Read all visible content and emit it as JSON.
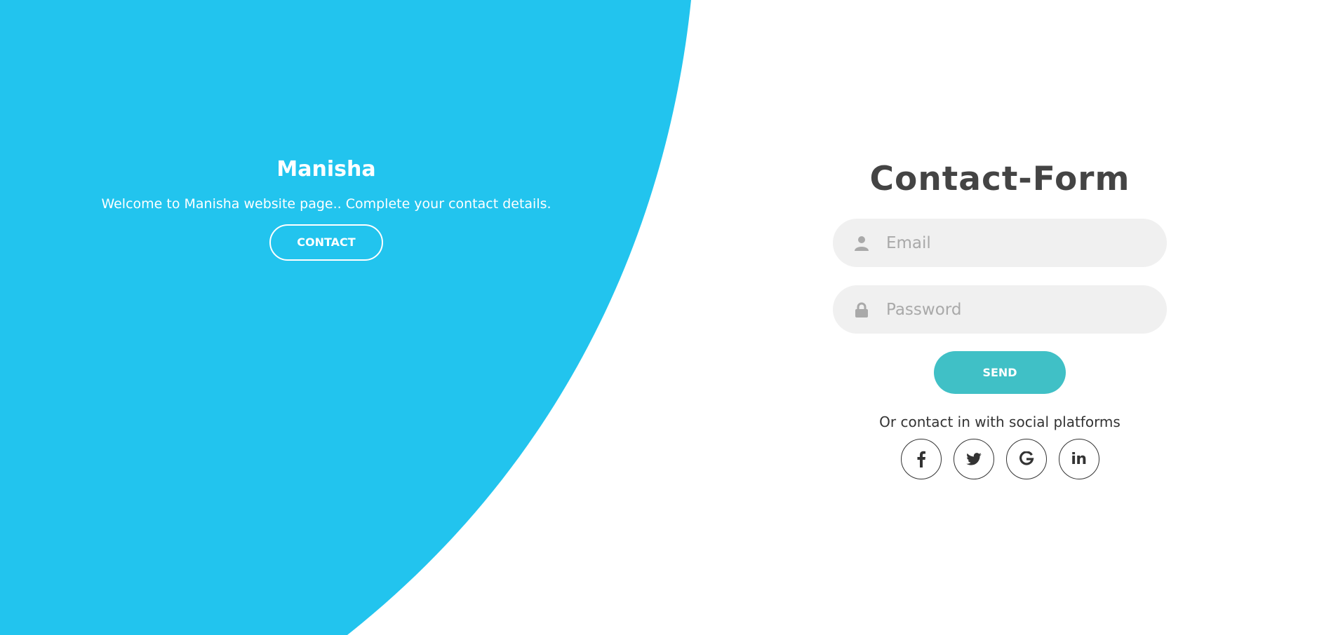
{
  "colors": {
    "accent_blue": "#22c4ee",
    "send_button": "#40c0c6",
    "field_background": "#f0f0f0",
    "title_text": "#444444"
  },
  "hero": {
    "title": "Manisha",
    "text": "Welcome to Manisha website page.. Complete your contact details.",
    "button_label": "CONTACT"
  },
  "form": {
    "title": "Contact-Form",
    "email": {
      "placeholder": "Email",
      "value": "",
      "icon": "user-icon"
    },
    "password": {
      "placeholder": "Password",
      "value": "",
      "icon": "lock-icon"
    },
    "submit_label": "SEND"
  },
  "social": {
    "text": "Or contact in with social platforms",
    "items": [
      {
        "icon": "facebook-icon"
      },
      {
        "icon": "twitter-icon"
      },
      {
        "icon": "google-icon"
      },
      {
        "icon": "linkedin-icon",
        "glyph": "in"
      }
    ]
  }
}
